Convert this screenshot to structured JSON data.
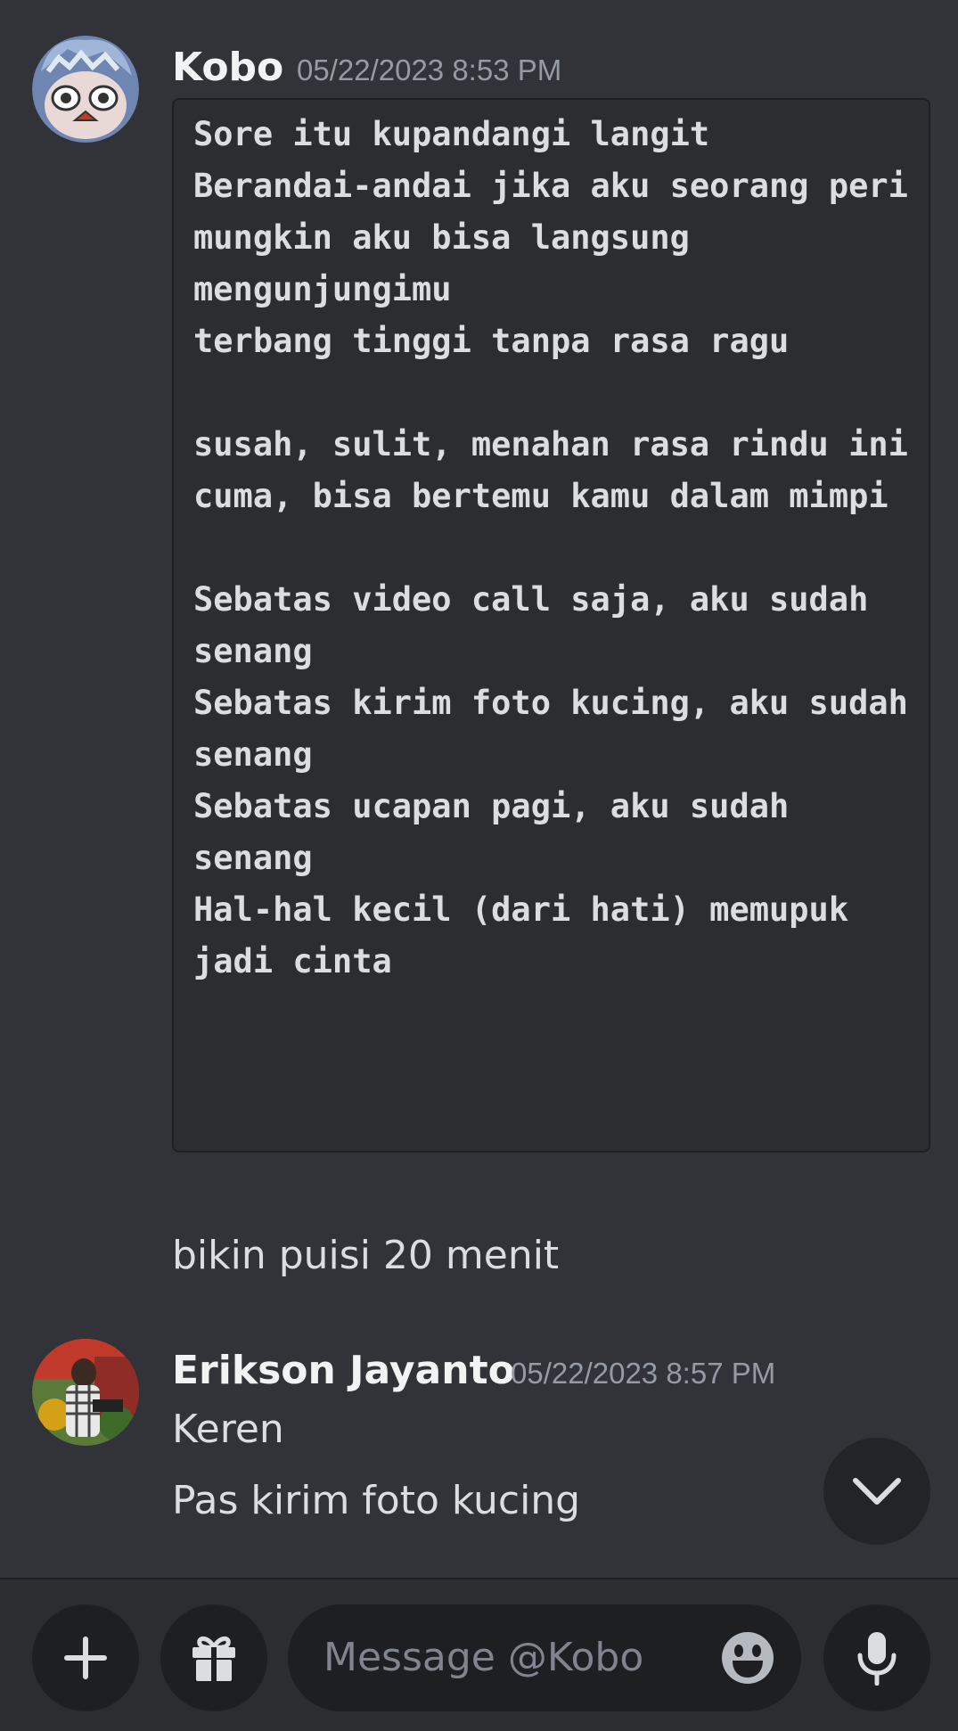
{
  "messages": [
    {
      "author": "Kobo",
      "timestamp": "05/22/2023 8:53 PM",
      "code": "Sore itu kupandangi langit\nBerandai-andai jika aku seorang peri\nmungkin aku bisa langsung mengunjungimu\nterbang tinggi tanpa rasa ragu\n\nsusah, sulit, menahan rasa rindu ini\ncuma, bisa bertemu kamu dalam mimpi\n\nSebatas video call saja, aku sudah senang\nSebatas kirim foto kucing, aku sudah senang\nSebatas ucapan pagi, aku sudah senang\nHal-hal kecil (dari hati) memupuk jadi cinta",
      "followup": "bikin puisi 20 menit"
    },
    {
      "author": "Erikson Jayanto",
      "timestamp": "05/22/2023 8:57 PM",
      "line1": "Keren",
      "line2": "Pas kirim foto kucing"
    }
  ],
  "composer": {
    "placeholder": "Message @Kobo"
  },
  "icons": {
    "add": "plus-icon",
    "gift": "gift-icon",
    "emoji": "emoji-icon",
    "mic": "microphone-icon",
    "scroll": "chevron-down-icon"
  },
  "colors": {
    "background": "#313338",
    "composer_bg": "#2b2d31",
    "input_bg": "#1e1f22",
    "text": "#dbdee1",
    "muted": "#949ba4"
  }
}
